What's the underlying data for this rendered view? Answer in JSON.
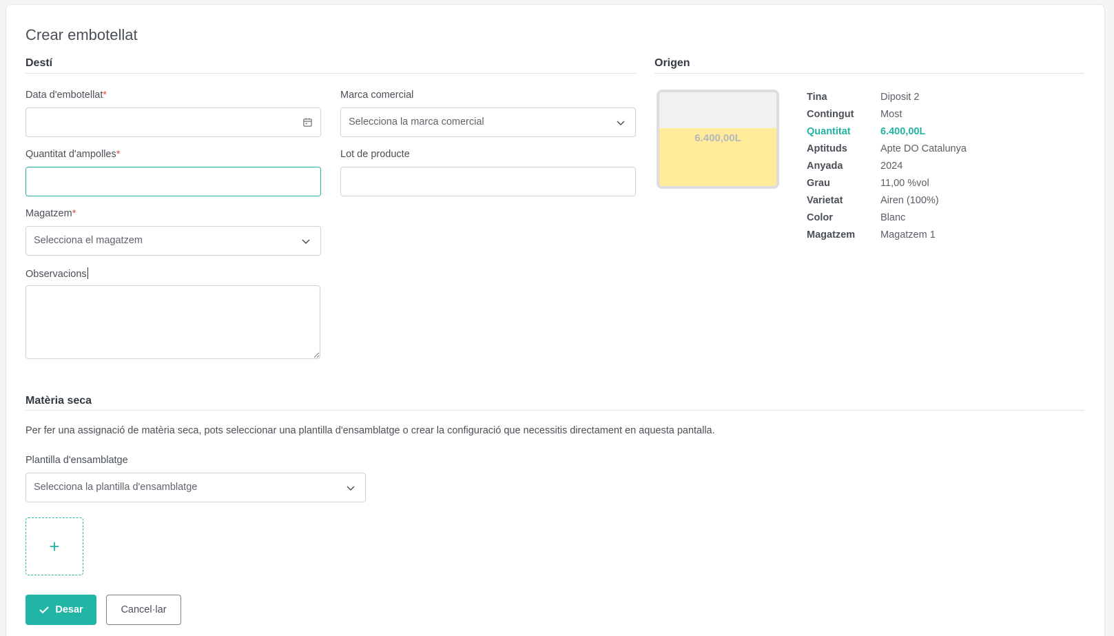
{
  "page": {
    "title": "Crear embotellat"
  },
  "destination": {
    "title": "Destí",
    "bottling_date": {
      "label": "Data d'embotellat",
      "required": "*",
      "value": ""
    },
    "trade_mark": {
      "label": "Marca comercial",
      "placeholder": "Selecciona la marca comercial"
    },
    "bottle_quantity": {
      "label": "Quantitat d'ampolles",
      "required": "*",
      "value": ""
    },
    "product_lot": {
      "label": "Lot de producte",
      "value": ""
    },
    "warehouse": {
      "label": "Magatzem",
      "required": "*",
      "placeholder": "Selecciona el magatzem"
    },
    "observations": {
      "label": "Observacions",
      "value": ""
    }
  },
  "origin": {
    "title": "Origen",
    "tank_level_label": "6.400,00L",
    "tank_fill_fraction": 0.62,
    "fill_color": "#ffeb99",
    "rows": [
      {
        "key": "Tina",
        "value": "Diposit 2"
      },
      {
        "key": "Contingut",
        "value": "Most"
      },
      {
        "key": "Quantitat",
        "value": "6.400,00L"
      },
      {
        "key": "Aptituds",
        "value": "Apte DO Catalunya"
      },
      {
        "key": "Anyada",
        "value": "2024"
      },
      {
        "key": "Grau",
        "value": "11,00 %vol"
      },
      {
        "key": "Varietat",
        "value": "Airen (100%)"
      },
      {
        "key": "Color",
        "value": "Blanc"
      },
      {
        "key": "Magatzem",
        "value": "Magatzem 1"
      }
    ]
  },
  "dry_matter": {
    "title": "Matèria seca",
    "description": "Per fer una assignació de matèria seca, pots seleccionar una plantilla d'ensamblatge o crear la configuració que necessitis directament en aquesta pantalla.",
    "template": {
      "label": "Plantilla d'ensamblatge",
      "placeholder": "Selecciona la plantilla d'ensamblatge"
    },
    "add_symbol": "+"
  },
  "actions": {
    "save": "Desar",
    "cancel": "Cancel·lar"
  },
  "colors": {
    "accent": "#21b5a6",
    "required": "#e0504a"
  }
}
